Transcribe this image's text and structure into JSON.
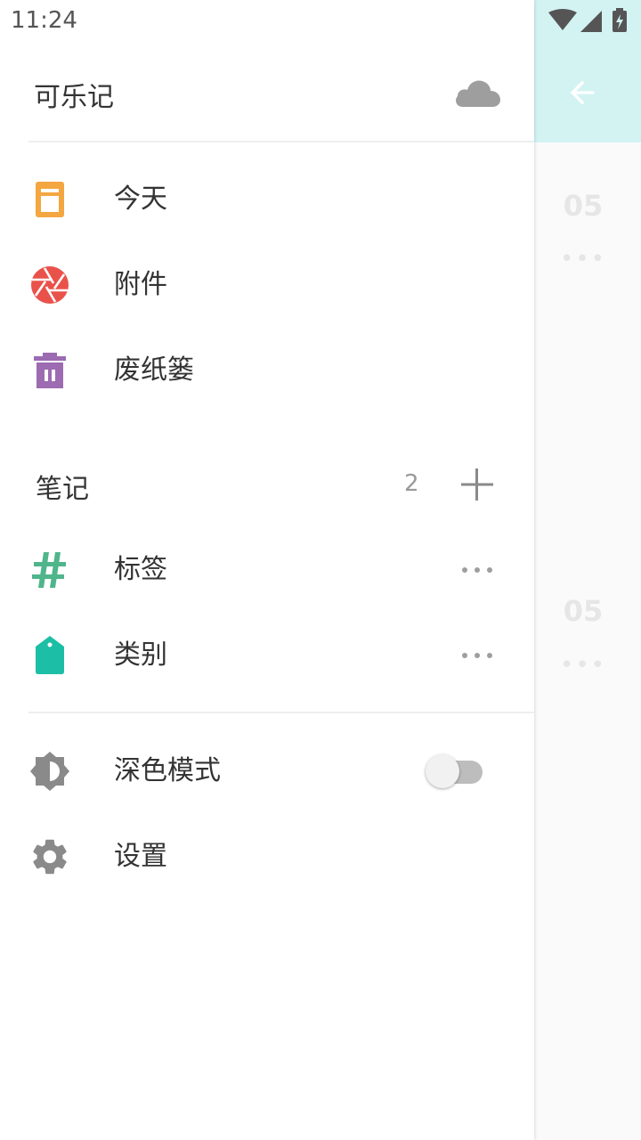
{
  "status_bar": {
    "time": "11:24"
  },
  "background": {
    "dates": [
      "05",
      "05"
    ],
    "more_dots": "•••",
    "header_color": "#d3f3f3"
  },
  "drawer": {
    "title": "可乐记",
    "top_items": [
      {
        "label": "今天",
        "icon": "today-icon",
        "color": "#f4a640"
      },
      {
        "label": "附件",
        "icon": "attachment-aperture-icon",
        "color": "#e9524a"
      },
      {
        "label": "废纸篓",
        "icon": "trash-icon",
        "color": "#9c6bb1"
      }
    ],
    "notes_section": {
      "label": "笔记",
      "count": "2"
    },
    "note_items": [
      {
        "label": "标签",
        "icon": "hashtag-icon",
        "color": "#4fb58b"
      },
      {
        "label": "类别",
        "icon": "category-tag-icon",
        "color": "#1cbfa5"
      }
    ],
    "bottom_items": [
      {
        "label": "深色模式",
        "icon": "brightness-icon",
        "toggle_on": false
      },
      {
        "label": "设置",
        "icon": "gear-icon"
      }
    ]
  }
}
